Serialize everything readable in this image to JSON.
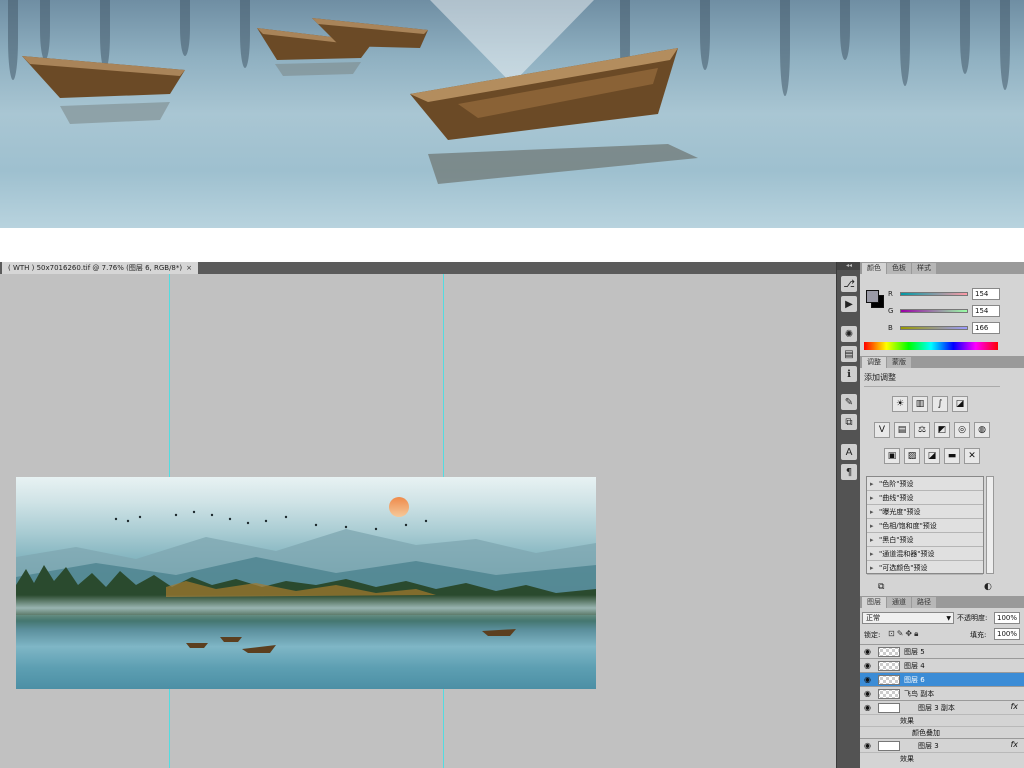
{
  "document_tab": {
    "title": "( WTH ) 50x7016260.tif @ 7.76% (图层 6, RGB/8*)",
    "close": "×"
  },
  "toolbar": {
    "grip": "◂◂"
  },
  "color_panel": {
    "tabs": [
      "颜色",
      "色板",
      "样式"
    ],
    "r": {
      "label": "R",
      "value": "154"
    },
    "g": {
      "label": "G",
      "value": "154"
    },
    "b": {
      "label": "B",
      "value": "166"
    }
  },
  "adjustments_panel": {
    "tabs": [
      "调整",
      "蒙版"
    ],
    "title": "添加调整",
    "presets": [
      "\"色阶\"预设",
      "\"曲线\"预设",
      "\"曝光度\"预设",
      "\"色相/饱和度\"预设",
      "\"黑白\"预设",
      "\"通道混和器\"预设",
      "\"可选颜色\"预设"
    ]
  },
  "layers_panel": {
    "tabs": [
      "图层",
      "通道",
      "路径"
    ],
    "blend_mode": "正常",
    "opacity_label": "不透明度:",
    "opacity_value": "100%",
    "lock_label": "锁定:",
    "fill_label": "填充:",
    "fill_value": "100%",
    "layers": [
      {
        "name": "图层 5"
      },
      {
        "name": "图层 4"
      },
      {
        "name": "图层 6",
        "selected": true
      },
      {
        "name": "飞鸟 副本"
      },
      {
        "name": "图层 3 副本",
        "fx": "fx"
      },
      {
        "name": "图层 3",
        "fx": "fx"
      }
    ],
    "effects_label": "效果",
    "color_overlay_label": "颜色叠加"
  },
  "colors": {
    "selected_layer": "#3b8cd6",
    "guide": "#3fe0e6",
    "workspace": "#c1c1c1"
  }
}
